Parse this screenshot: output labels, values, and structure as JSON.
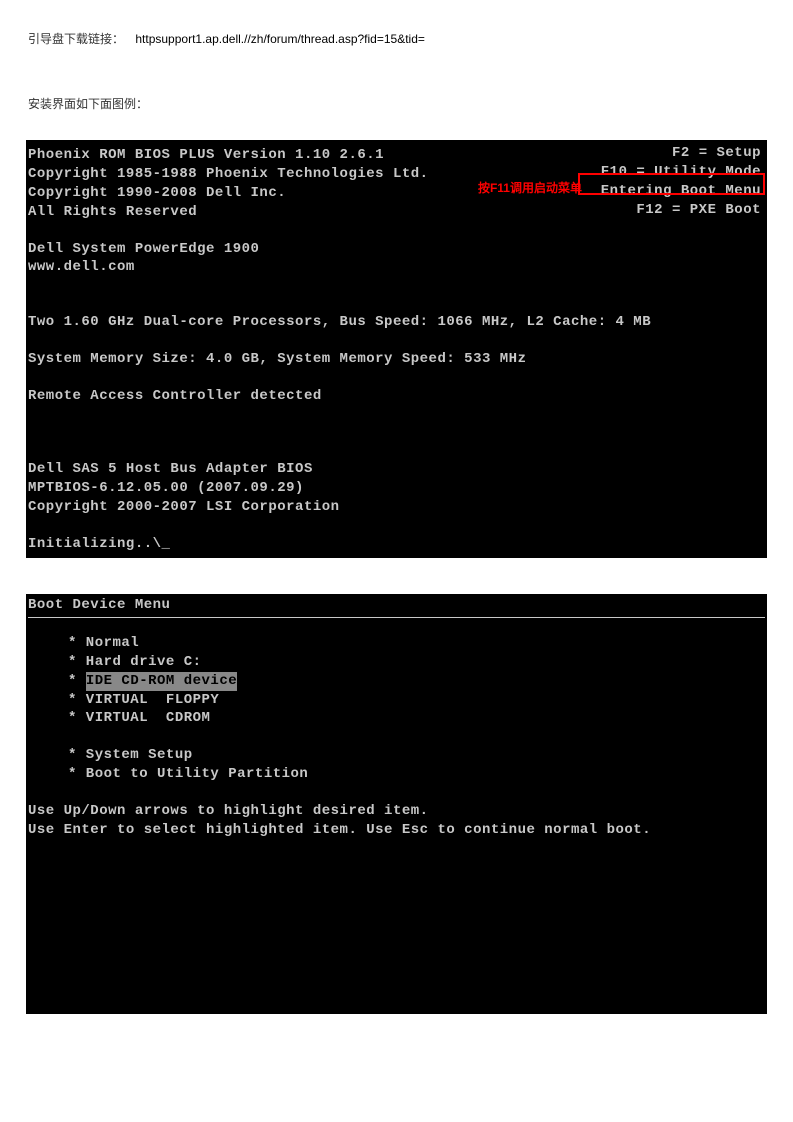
{
  "doc": {
    "link_label": "引导盘下载链接：",
    "link_url": "httpsupport1.ap.dell.//zh/forum/thread.asp?fid=15&tid=",
    "subtitle": "安装界面如下面图例："
  },
  "bios": {
    "top_right": {
      "f2": "F2 = Setup",
      "f10": "F10 = Utility Mode",
      "entering": "Entering Boot Menu",
      "f12": "F12 = PXE Boot"
    },
    "annotation": "按F11调用启动菜单",
    "lines": {
      "l1": "Phoenix ROM BIOS PLUS Version 1.10 2.6.1",
      "l2": "Copyright 1985-1988 Phoenix Technologies Ltd.",
      "l3": "Copyright 1990-2008 Dell Inc.",
      "l4": "All Rights Reserved",
      "l5": "Dell System PowerEdge 1900",
      "l6": "www.dell.com",
      "l7": "Two 1.60 GHz Dual-core Processors, Bus Speed: 1066 MHz, L2 Cache: 4 MB",
      "l8": "System Memory Size: 4.0 GB, System Memory Speed: 533 MHz",
      "l9": "Remote Access Controller detected",
      "l10": "Dell SAS 5 Host Bus Adapter BIOS",
      "l11": "MPTBIOS-6.12.05.00 (2007.09.29)",
      "l12": "Copyright 2000-2007 LSI Corporation",
      "l13": "Initializing..\\_"
    }
  },
  "boot_menu": {
    "title": "Boot Device Menu",
    "items": {
      "normal": "* Normal",
      "hdd": "* Hard drive C:",
      "cdrom_prefix": "* ",
      "cdrom": "IDE CD-ROM device",
      "vfloppy": "* VIRTUAL  FLOPPY",
      "vcdrom": "* VIRTUAL  CDROM",
      "setup": "* System Setup",
      "utility": "* Boot to Utility Partition"
    },
    "instructions": {
      "i1": "Use Up/Down arrows to highlight desired item.",
      "i2": "Use Enter to select highlighted item. Use Esc to continue normal boot."
    }
  }
}
